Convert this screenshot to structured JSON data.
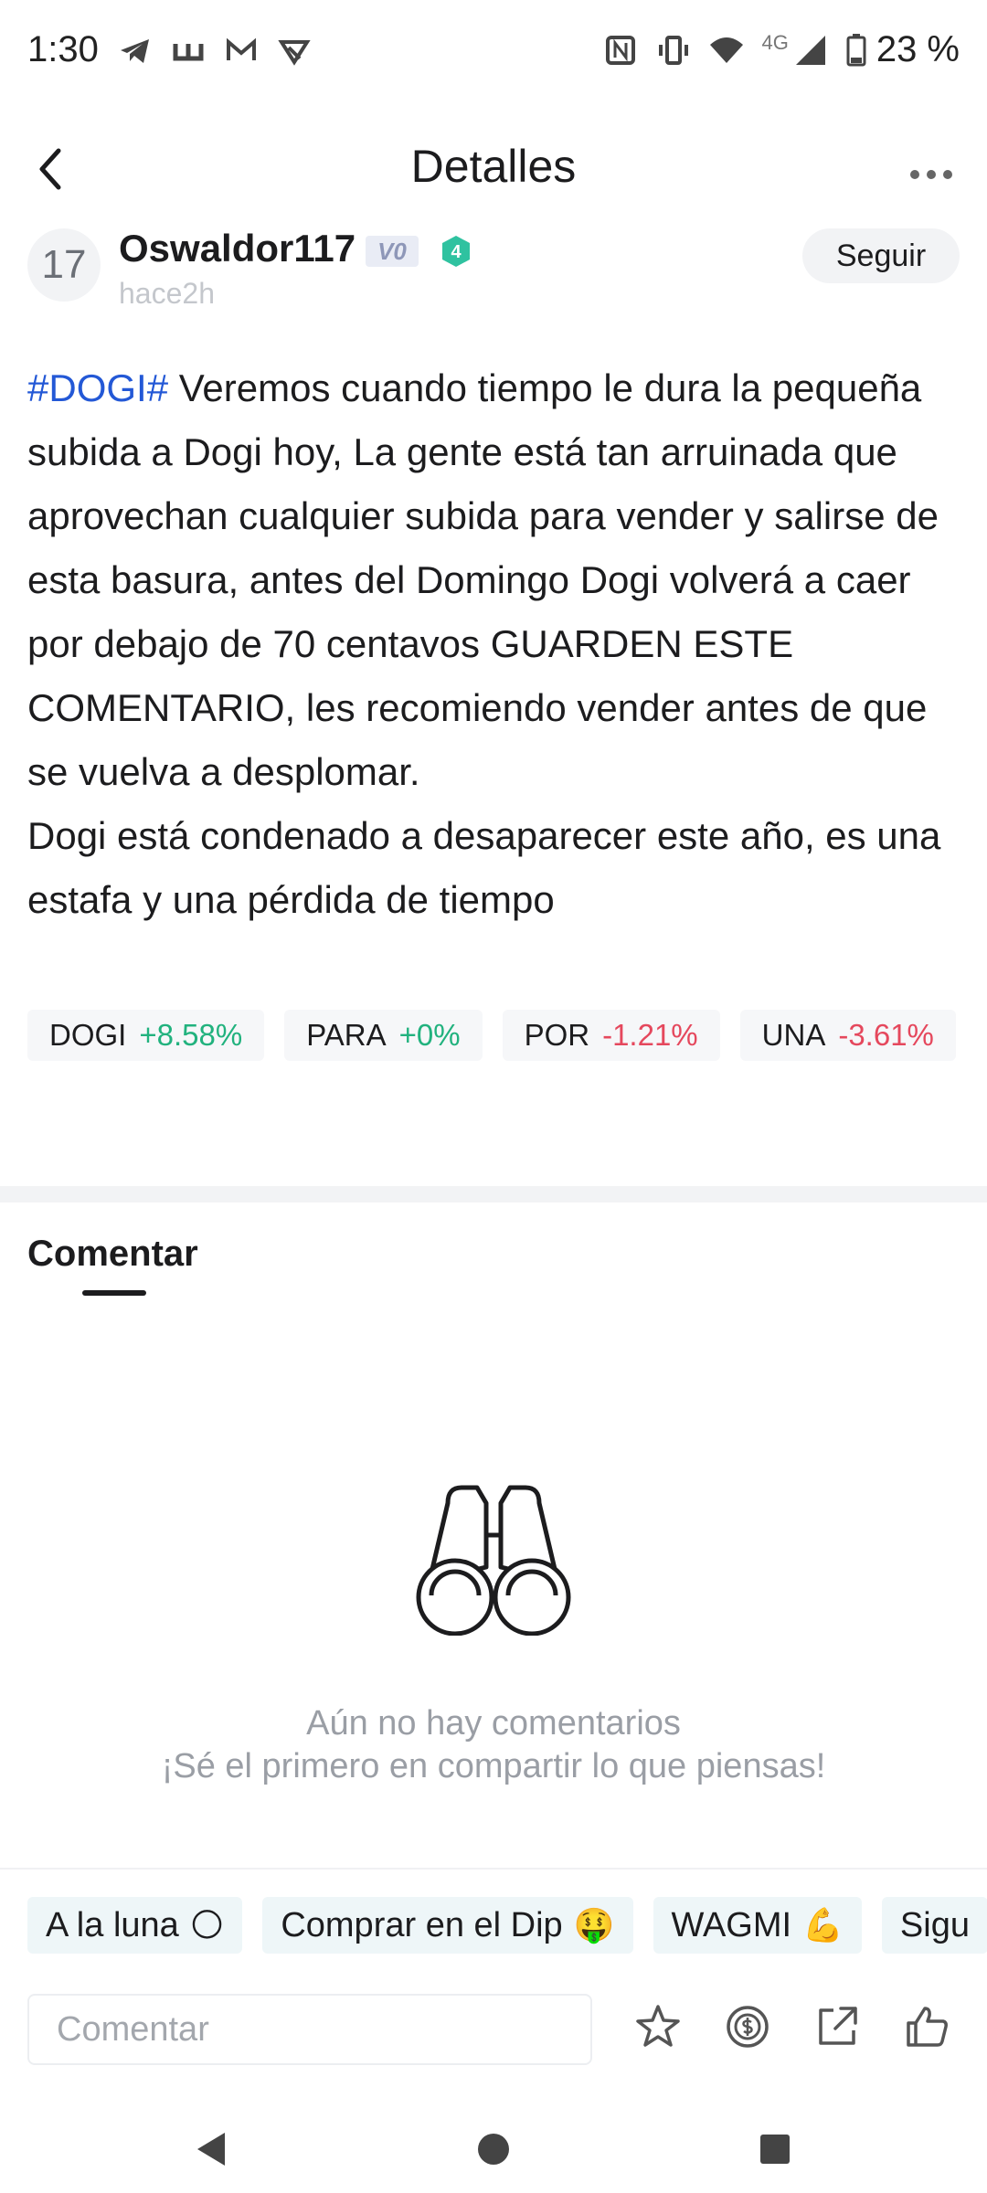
{
  "status_bar": {
    "time": "1:30",
    "network": "4G",
    "battery": "23 %"
  },
  "header": {
    "title": "Detalles"
  },
  "author": {
    "avatar_text": "17",
    "name": "Oswaldor117",
    "level": "V0",
    "badge": "4",
    "time_ago": "hace2h",
    "follow_label": "Seguir"
  },
  "post": {
    "hashtag": "#DOGI#",
    "paragraph1": " Veremos cuando tiempo le dura la pequeña subida a Dogi hoy, La gente está tan arruinada que aprovechan cualquier subida para vender y salirse de esta basura, antes del Domingo Dogi volverá a caer por debajo de 70 centavos GUARDEN ESTE COMENTARIO, les recomiendo vender antes de que se vuelva a desplomar.",
    "paragraph2": "Dogi está condenado a desaparecer este año, es una estafa y una pérdida de tiempo"
  },
  "tickers": [
    {
      "symbol": "DOGI",
      "change": "+8.58%"
    },
    {
      "symbol": "PARA",
      "change": "+0%"
    },
    {
      "symbol": "POR",
      "change": "-1.21%"
    },
    {
      "symbol": "UNA",
      "change": "-3.61%"
    }
  ],
  "comments": {
    "tab_label": "Comentar",
    "empty_line1": "Aún no hay comentarios",
    "empty_line2": "¡Sé el primero en compartir lo que piensas!"
  },
  "quick_replies": [
    {
      "label": "A la luna",
      "emoji": "🌕"
    },
    {
      "label": "Comprar en el Dip",
      "emoji": "🤑"
    },
    {
      "label": "WAGMI",
      "emoji": "💪"
    },
    {
      "label": "Sigu",
      "emoji": ""
    }
  ],
  "input": {
    "placeholder": "Comentar"
  },
  "colors": {
    "up": "#21b27e",
    "down": "#e5485d",
    "hashtag": "#2358d6"
  }
}
